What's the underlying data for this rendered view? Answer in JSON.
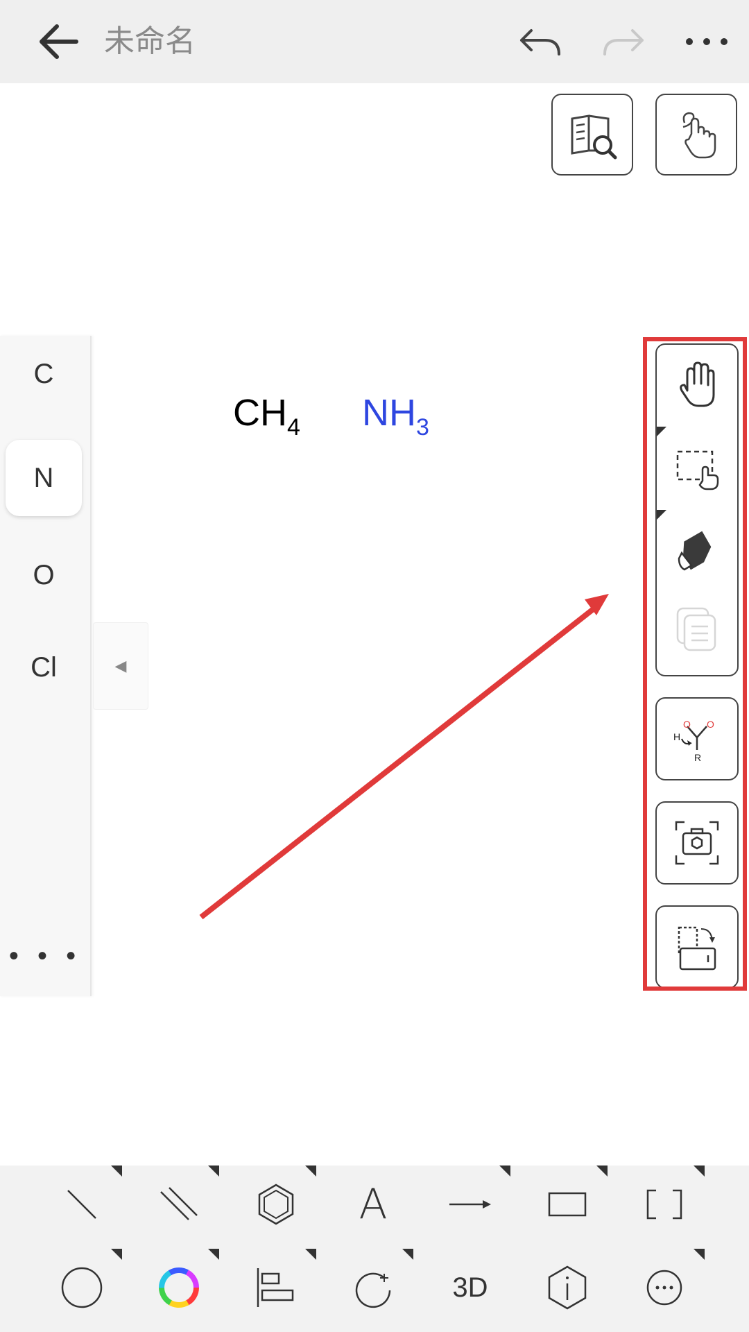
{
  "topbar": {
    "title": "未命名",
    "back_icon": "arrow-left-icon",
    "undo_icon": "undo-icon",
    "redo_icon": "redo-icon",
    "more_icon": "more-horizontal-icon"
  },
  "top_tools": [
    "book-search-icon",
    "hand-gesture-icon"
  ],
  "element_panel": {
    "items": [
      "C",
      "N",
      "O",
      "Cl"
    ],
    "selected": "N",
    "more_label": "• • •",
    "collapse_glyph": "◀"
  },
  "canvas": {
    "formulas": [
      {
        "base": "CH",
        "sub": "4",
        "color": "#000000"
      },
      {
        "base": "NH",
        "sub": "3",
        "color": "#2e46e0"
      }
    ],
    "annotation_arrow_color": "#e03a3a"
  },
  "right_toolbar": {
    "group": [
      "hand-pan-icon",
      "select-rect-icon",
      "eraser-icon",
      "copy-icon"
    ],
    "buttons": [
      "reaction-mechanism-icon",
      "camera-recognize-icon",
      "page-rotate-icon"
    ],
    "mechanism_labels": {
      "h": "H",
      "o1": "O",
      "o2": "O",
      "r": "R"
    }
  },
  "bottom_toolbar": {
    "row1": [
      "single-bond-icon",
      "double-bond-icon",
      "benzene-ring-icon",
      "text-icon",
      "arrow-icon",
      "rectangle-icon",
      "bracket-icon"
    ],
    "row2": [
      "circle-icon",
      "color-wheel-icon",
      "align-icon",
      "rotate-add-icon",
      "3d-icon",
      "info-hexagon-icon",
      "more-circle-icon"
    ],
    "text_label": "A",
    "three_d_label": "3D"
  }
}
